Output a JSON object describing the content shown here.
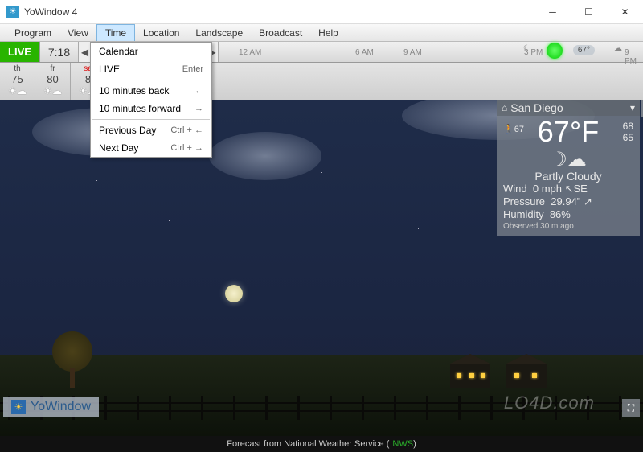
{
  "window": {
    "title": "YoWindow 4"
  },
  "menubar": [
    "Program",
    "View",
    "Time",
    "Location",
    "Landscape",
    "Broadcast",
    "Help"
  ],
  "active_menu_index": 2,
  "dropdown": {
    "items": [
      {
        "label": "Calendar",
        "shortcut": ""
      },
      {
        "label": "LIVE",
        "shortcut": "Enter"
      },
      {
        "label": "10 minutes back",
        "shortcut": "←"
      },
      {
        "label": "10 minutes forward",
        "shortcut": "→"
      },
      {
        "label": "Previous Day",
        "shortcut": "Ctrl + ←"
      },
      {
        "label": "Next Day",
        "shortcut": "Ctrl + →"
      }
    ],
    "sep_after": [
      1,
      3
    ]
  },
  "toolbar": {
    "live": "LIVE",
    "time": "7:18",
    "timeline_ticks": [
      {
        "label": "12 AM",
        "pos": 25
      },
      {
        "label": "6 AM",
        "pos": 170
      },
      {
        "label": "9 AM",
        "pos": 230
      },
      {
        "label": "3 PM",
        "pos": 380
      },
      {
        "label": "9 PM",
        "pos": 505
      }
    ],
    "pill_temp": "67°"
  },
  "forecast": [
    {
      "dow": "th",
      "hi": "75",
      "today": false
    },
    {
      "dow": "fr",
      "hi": "80",
      "today": false
    },
    {
      "dow": "sa",
      "hi": "8",
      "today": true
    }
  ],
  "panel": {
    "city": "San Diego",
    "feels": "67",
    "temp": "67°F",
    "hi": "68",
    "lo": "65",
    "condition": "Partly Cloudy",
    "wind_label": "Wind",
    "wind": "0 mph",
    "wind_dir": "SE",
    "press_label": "Pressure",
    "pressure": "29.94\"",
    "hum_label": "Humidity",
    "humidity": "86%",
    "observed": "Observed 30 m ago"
  },
  "footer": {
    "prefix": "Forecast from National Weather Service (",
    "link": "NWS",
    "suffix": ")"
  },
  "logo": "YoWindow",
  "watermark": "LO4D.com"
}
